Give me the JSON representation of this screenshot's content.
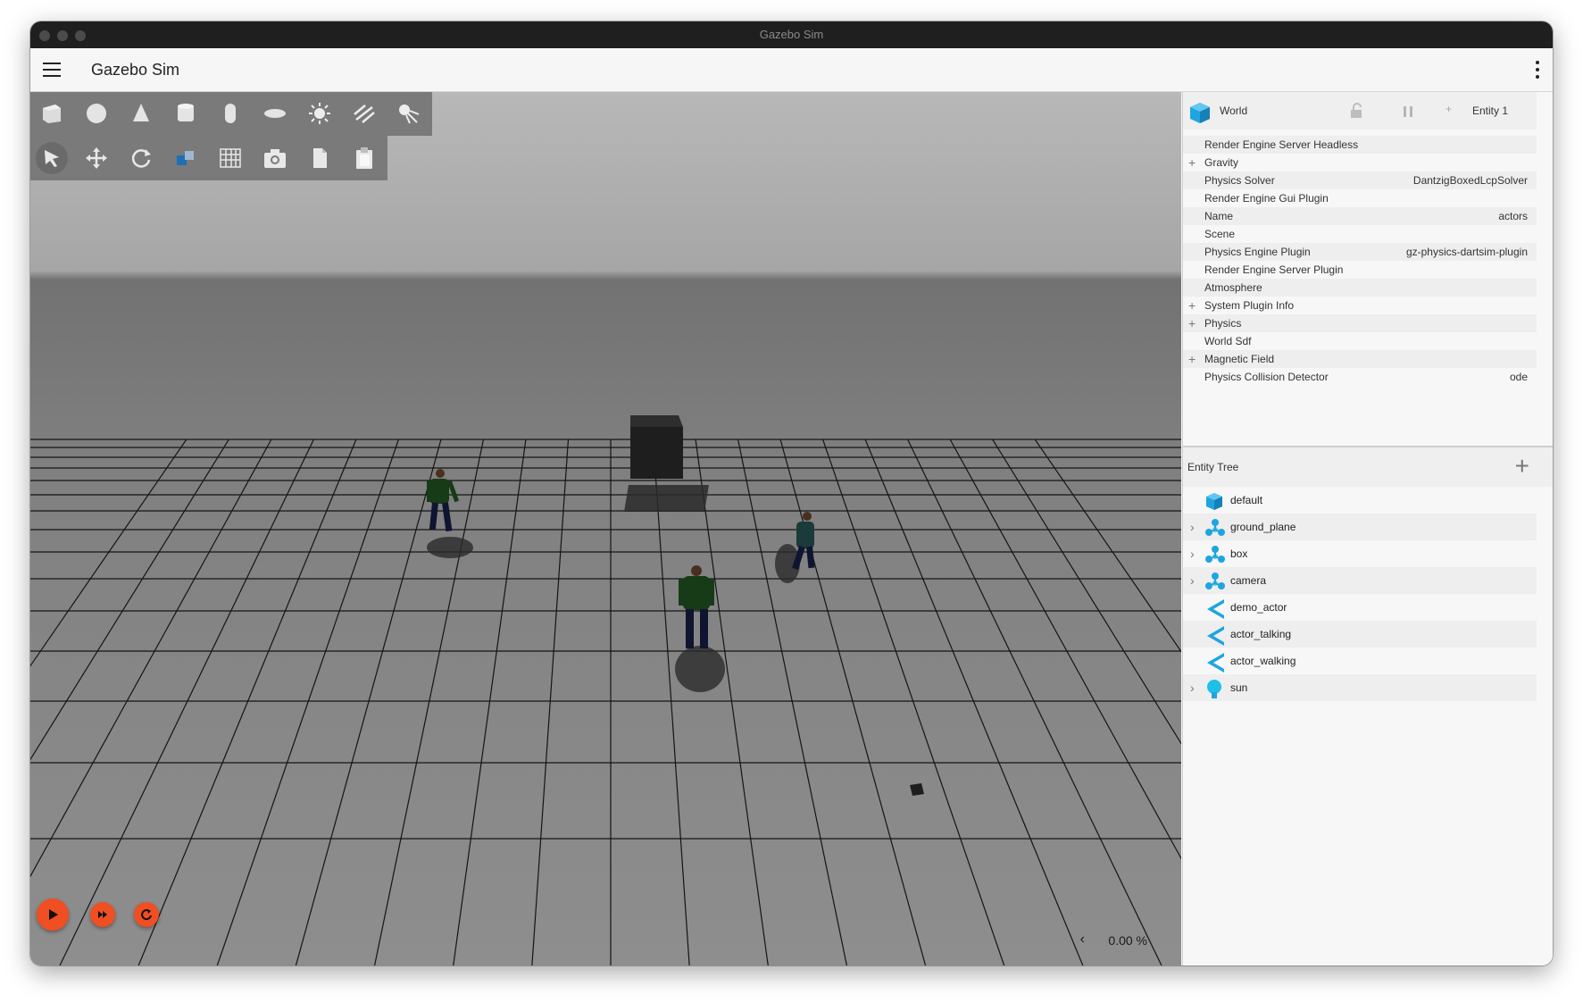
{
  "window": {
    "title": "Gazebo Sim"
  },
  "appbar": {
    "title": "Gazebo Sim",
    "menu_icon": "hamburger-menu-icon",
    "more_icon": "more-vertical-icon"
  },
  "toolbar": {
    "shapes": [
      {
        "name": "box-icon"
      },
      {
        "name": "sphere-icon"
      },
      {
        "name": "cone-icon"
      },
      {
        "name": "cylinder-icon"
      },
      {
        "name": "capsule-icon"
      },
      {
        "name": "ellipsoid-icon"
      },
      {
        "name": "point-light-icon"
      },
      {
        "name": "directional-light-icon"
      },
      {
        "name": "spot-light-icon"
      }
    ],
    "transforms": [
      {
        "name": "select-icon"
      },
      {
        "name": "translate-icon"
      },
      {
        "name": "rotate-icon"
      },
      {
        "name": "align-icon"
      },
      {
        "name": "grid-snap-icon"
      },
      {
        "name": "screenshot-icon"
      },
      {
        "name": "copy-icon"
      },
      {
        "name": "paste-icon"
      }
    ]
  },
  "playback": {
    "play_icon": "play-icon",
    "step_icon": "step-forward-icon",
    "reset_icon": "reset-icon",
    "accent": "#f04e23"
  },
  "stats": {
    "rtf": "0.00 %"
  },
  "component_inspector": {
    "entity_name": "World",
    "entity_id": "Entity 1",
    "properties": [
      {
        "name": "Render Engine Server Headless",
        "value": "",
        "expandable": false
      },
      {
        "name": "Gravity",
        "value": "",
        "expandable": true
      },
      {
        "name": "Physics Solver",
        "value": "DantzigBoxedLcpSolver",
        "expandable": false
      },
      {
        "name": "Render Engine Gui Plugin",
        "value": "",
        "expandable": false
      },
      {
        "name": "Name",
        "value": "actors",
        "expandable": false
      },
      {
        "name": "Scene",
        "value": "",
        "expandable": false
      },
      {
        "name": "Physics Engine Plugin",
        "value": "gz-physics-dartsim-plugin",
        "expandable": false
      },
      {
        "name": "Render Engine Server Plugin",
        "value": "",
        "expandable": false
      },
      {
        "name": "Atmosphere",
        "value": "",
        "expandable": false
      },
      {
        "name": "System Plugin Info",
        "value": "",
        "expandable": true
      },
      {
        "name": "Physics",
        "value": "",
        "expandable": true
      },
      {
        "name": "World Sdf",
        "value": "",
        "expandable": false
      },
      {
        "name": "Magnetic Field",
        "value": "",
        "expandable": true
      },
      {
        "name": "Physics Collision Detector",
        "value": "ode",
        "expandable": false
      }
    ]
  },
  "entity_tree": {
    "title": "Entity Tree",
    "nodes": [
      {
        "label": "default",
        "icon": "world-icon",
        "expandable": false
      },
      {
        "label": "ground_plane",
        "icon": "model-icon",
        "expandable": true
      },
      {
        "label": "box",
        "icon": "model-icon",
        "expandable": true
      },
      {
        "label": "camera",
        "icon": "model-icon",
        "expandable": true
      },
      {
        "label": "demo_actor",
        "icon": "actor-icon",
        "expandable": false
      },
      {
        "label": "actor_talking",
        "icon": "actor-icon",
        "expandable": false
      },
      {
        "label": "actor_walking",
        "icon": "actor-icon",
        "expandable": false
      },
      {
        "label": "sun",
        "icon": "light-icon",
        "expandable": true
      }
    ]
  }
}
